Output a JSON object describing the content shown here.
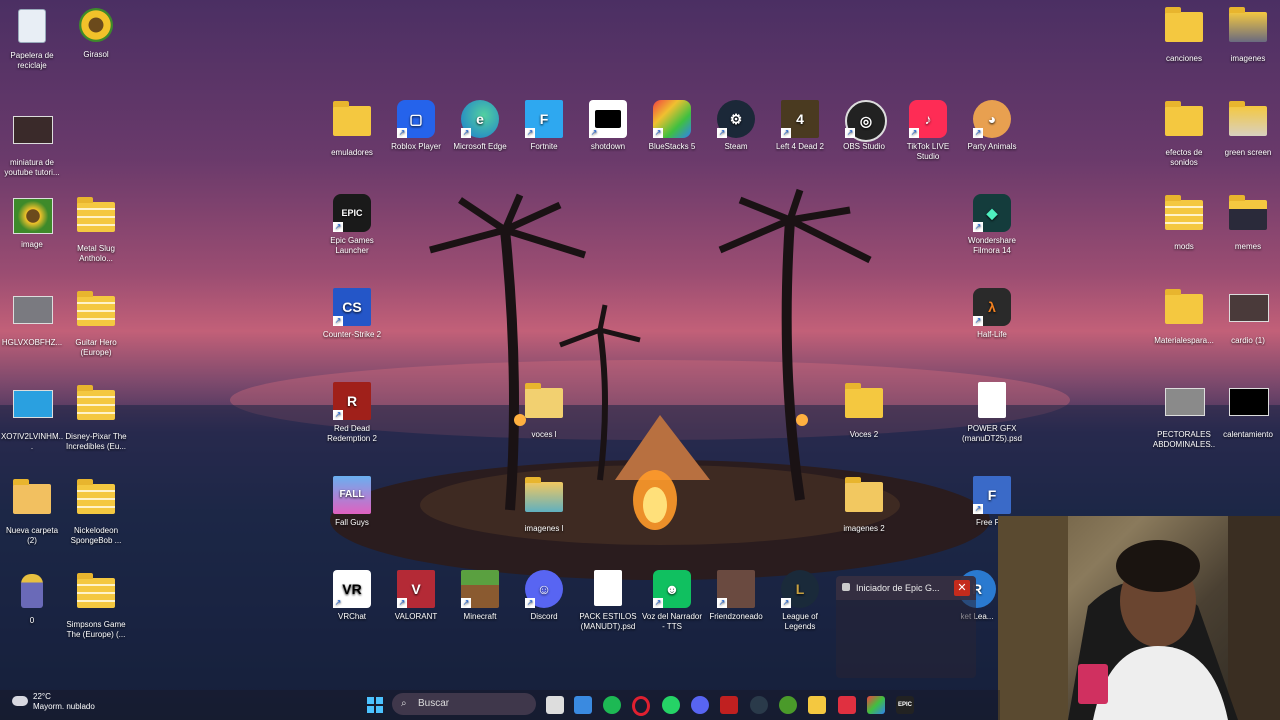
{
  "desktop": {
    "icons_left": [
      {
        "label": "Papelera de reciclaje"
      },
      {
        "label": "Girasol"
      },
      {
        "label": "miniatura de youtube tutori..."
      },
      {
        "label": "image"
      },
      {
        "label": "Metal Slug Antholo..."
      },
      {
        "label": "HGLVXOBFHZ..."
      },
      {
        "label": "Guitar Hero (Europe)"
      },
      {
        "label": "XO7IV2LVINHM..."
      },
      {
        "label": "Disney-Pixar The Incredibles (Eu..."
      },
      {
        "label": "Nueva carpeta (2)"
      },
      {
        "label": "Nickelodeon SpongeBob ..."
      },
      {
        "label": "0"
      },
      {
        "label": "Simpsons Game The (Europe) (..."
      }
    ],
    "icons_row1": [
      {
        "label": "emuladores"
      },
      {
        "label": "Roblox Player"
      },
      {
        "label": "Microsoft Edge"
      },
      {
        "label": "Fortnite"
      },
      {
        "label": "shotdown"
      },
      {
        "label": "BlueStacks 5"
      },
      {
        "label": "Steam"
      },
      {
        "label": "Left 4 Dead 2"
      },
      {
        "label": "OBS Studio"
      },
      {
        "label": "TikTok LIVE Studio"
      },
      {
        "label": "Party Animals"
      }
    ],
    "icons_col": [
      {
        "label": "Epic Games Launcher"
      },
      {
        "label": "Counter-Strike 2"
      },
      {
        "label": "Red Dead Redemption 2"
      },
      {
        "label": "Fall Guys"
      }
    ],
    "icons_mid": [
      {
        "label": "voces l"
      },
      {
        "label": "Voces 2"
      },
      {
        "label": "imagenes l"
      },
      {
        "label": "imagenes 2"
      }
    ],
    "icons_right_col": [
      {
        "label": "Wondershare Filmora 14"
      },
      {
        "label": "Half-Life"
      },
      {
        "label": "POWER GFX (manuDT25).psd"
      },
      {
        "label": "Free Fi..."
      }
    ],
    "icons_bottom": [
      {
        "label": "VRChat"
      },
      {
        "label": "VALORANT"
      },
      {
        "label": "Minecraft"
      },
      {
        "label": "Discord"
      },
      {
        "label": "PACK ESTILOS (MANUDT).psd"
      },
      {
        "label": "Voz del Narrador - TTS"
      },
      {
        "label": "Friendzoneado"
      },
      {
        "label": "League of Legends"
      },
      {
        "label": "ket Lea..."
      }
    ],
    "icons_far_right": [
      {
        "label": "canciones"
      },
      {
        "label": "imagenes"
      },
      {
        "label": "efectos de sonidos"
      },
      {
        "label": "green screen"
      },
      {
        "label": "mods"
      },
      {
        "label": "memes"
      },
      {
        "label": "Materialespara..."
      },
      {
        "label": "cardio (1)"
      },
      {
        "label": "PECTORALES ABDOMINALES..."
      },
      {
        "label": "calentamiento"
      }
    ]
  },
  "popup": {
    "title": "Iniciador de Epic G...",
    "close_glyph": "✕"
  },
  "taskbar": {
    "weather": {
      "temp": "22°C",
      "condition": "Mayorm. nublado"
    },
    "search_placeholder": "Buscar",
    "search_icon": "⌕",
    "apps": [
      "start-icon",
      "task-view-icon",
      "notepad-icon",
      "spotify-icon",
      "opera-icon",
      "whatsapp-icon",
      "discord-icon",
      "app-icon",
      "steam-icon",
      "xbox-icon",
      "file-explorer-icon",
      "app2-icon",
      "bluestacks-icon",
      "epic-icon"
    ]
  },
  "colors": {
    "folder": "#f4c840",
    "close_red": "#c42b1c"
  }
}
